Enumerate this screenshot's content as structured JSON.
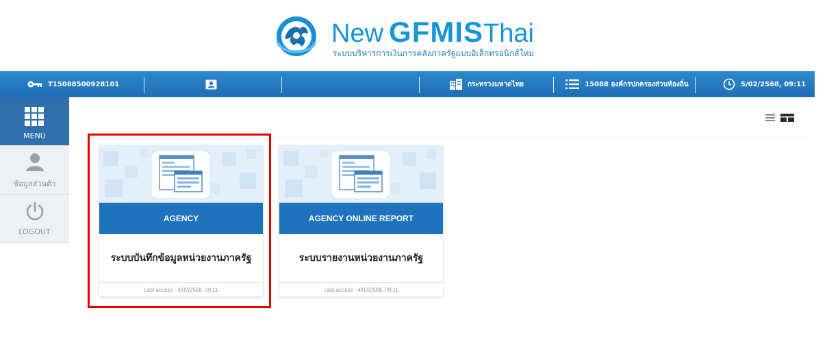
{
  "brand": {
    "title_new": "New",
    "title_gfmis": "GFMIS",
    "title_thai": "Thai",
    "subtitle": "ระบบบริหารการเงินการคลังภาครัฐแบบอิเล็กทรอนิกส์ใหม่",
    "color": "#1596d6"
  },
  "topbar": {
    "user_id": "T15088500928101",
    "ministry": "กระทรวงมหาดไทย",
    "department": "15088 องค์กรปกครองส่วนท้องถิ่น",
    "datetime": "5/02/2568, 09:11",
    "icons": [
      "key-icon",
      "profile-card-icon",
      "building-icon",
      "list-icon",
      "clock-icon"
    ],
    "color": "#1e6fb5"
  },
  "sidebar": {
    "items": [
      {
        "label": "MENU",
        "icon": "grid-menu-icon"
      },
      {
        "label": "ข้อมูลส่วนตัว",
        "icon": "user-icon"
      },
      {
        "label": "LOGOUT",
        "icon": "power-icon"
      }
    ],
    "active_color": "#2f6fae"
  },
  "view_toggle": {
    "icons": [
      "list-view-icon",
      "card-view-icon"
    ]
  },
  "cards": [
    {
      "band_label": "AGENCY",
      "title": "ระบบบันทึกข้อมูลหน่วยงานภาครัฐ",
      "last_access": "Last access : 4/02/2568, 09:11",
      "highlighted": true
    },
    {
      "band_label": "AGENCY ONLINE REPORT",
      "title": "ระบบรายงานหน่วยงานภาครัฐ",
      "last_access": "Last access : 4/02/2568, 09:11",
      "highlighted": false
    }
  ],
  "highlight_color": "#e60000"
}
